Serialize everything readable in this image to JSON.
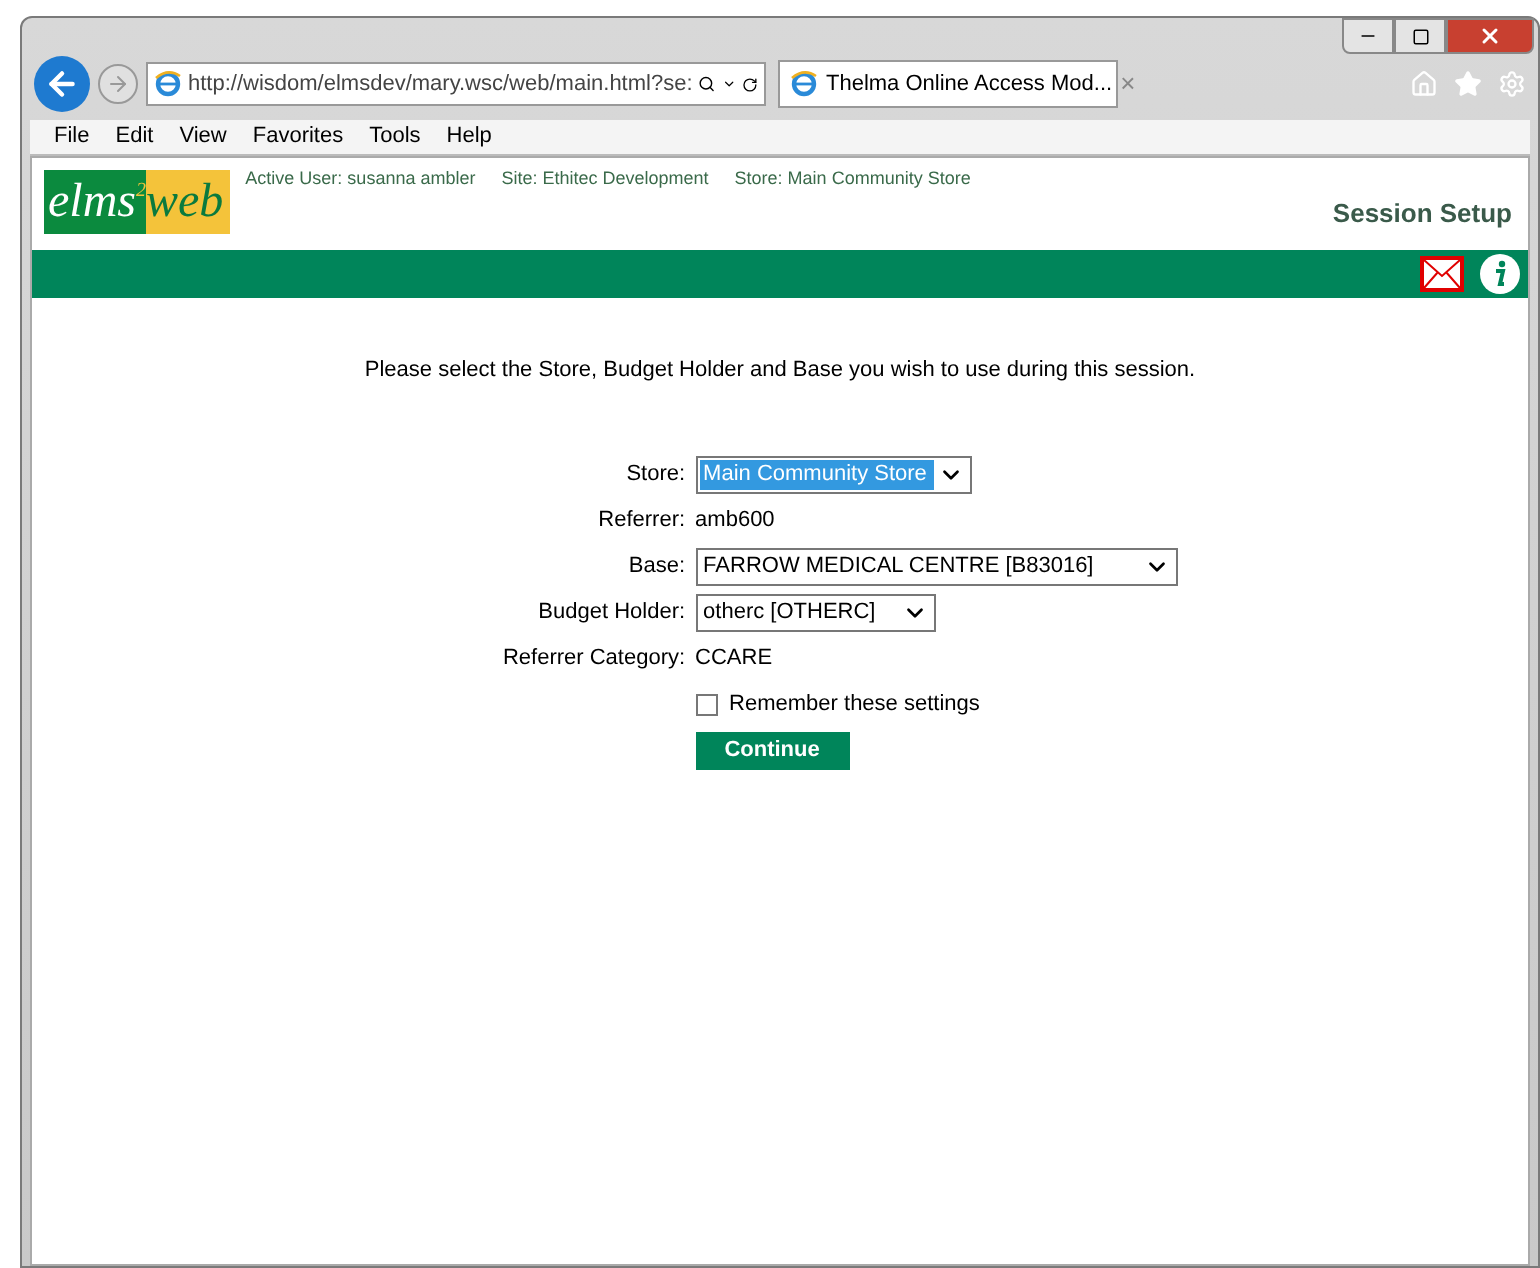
{
  "browser": {
    "address": "http://wisdom/elmsdev/mary.wsc/web/main.html?se:",
    "tab_title": "Thelma Online Access Mod...",
    "tab_close": "×",
    "menu": [
      "File",
      "Edit",
      "View",
      "Favorites",
      "Tools",
      "Help"
    ]
  },
  "header": {
    "logo": {
      "left": "elms",
      "sup": "2",
      "right": "web"
    },
    "status": [
      "Active User: susanna ambler",
      "Site: Ethitec Development",
      "Store: Main Community Store"
    ],
    "page_title": "Session Setup"
  },
  "form": {
    "intro": "Please select the Store, Budget Holder and Base you wish to use during this session.",
    "rows": [
      {
        "kind": "select",
        "label": "Store:",
        "value": "Main Community Store",
        "highlighted": true
      },
      {
        "kind": "text",
        "label": "Referrer:",
        "value": "amb600"
      },
      {
        "kind": "select",
        "label": "Base:",
        "value": "FARROW MEDICAL CENTRE [B83016]",
        "highlighted": false
      },
      {
        "kind": "select",
        "label": "Budget Holder:",
        "value": "otherc [OTHERC]",
        "highlighted": false
      },
      {
        "kind": "text",
        "label": "Referrer Category:",
        "value": "CCARE"
      }
    ],
    "remember": {
      "label": "Remember these settings",
      "checked": false
    },
    "button": "Continue"
  }
}
